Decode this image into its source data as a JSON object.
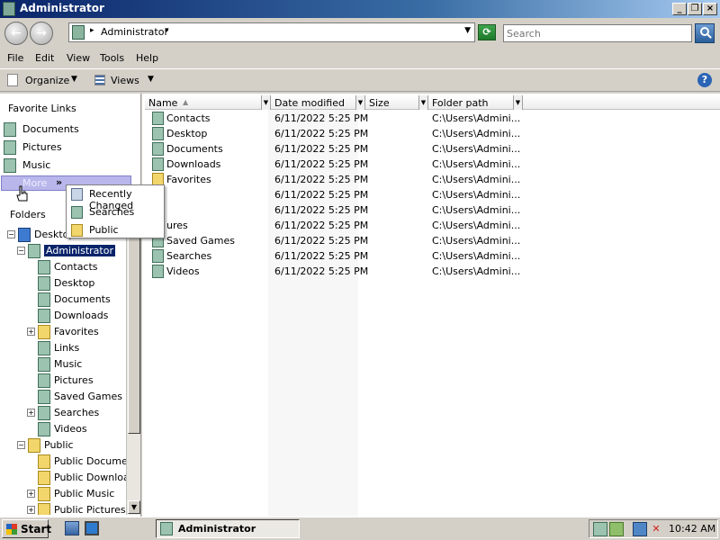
{
  "window": {
    "title": "Administrator"
  },
  "address": {
    "location": "Administrator",
    "search_placeholder": "Search"
  },
  "menu": [
    "File",
    "Edit",
    "View",
    "Tools",
    "Help"
  ],
  "toolbar": {
    "organize": "Organize",
    "views": "Views"
  },
  "nav": {
    "favorites_heading": "Favorite Links",
    "favorites": [
      "Documents",
      "Pictures",
      "Music"
    ],
    "more_label": "More",
    "more_chevron": "»",
    "folders_heading": "Folders"
  },
  "popup": {
    "items": [
      "Recently Changed",
      "Searches",
      "Public"
    ]
  },
  "tree": [
    {
      "label": "Desktop",
      "depth": 0,
      "expander": "−",
      "icon": "monitor"
    },
    {
      "label": "Administrator",
      "depth": 1,
      "expander": "−",
      "icon": "green",
      "selected": true
    },
    {
      "label": "Contacts",
      "depth": 2,
      "icon": "green"
    },
    {
      "label": "Desktop",
      "depth": 2,
      "icon": "green"
    },
    {
      "label": "Documents",
      "depth": 2,
      "icon": "green"
    },
    {
      "label": "Downloads",
      "depth": 2,
      "icon": "green"
    },
    {
      "label": "Favorites",
      "depth": 2,
      "expander": "+",
      "icon": "yellow"
    },
    {
      "label": "Links",
      "depth": 2,
      "icon": "green"
    },
    {
      "label": "Music",
      "depth": 2,
      "icon": "green"
    },
    {
      "label": "Pictures",
      "depth": 2,
      "icon": "green"
    },
    {
      "label": "Saved Games",
      "depth": 2,
      "icon": "green"
    },
    {
      "label": "Searches",
      "depth": 2,
      "expander": "+",
      "icon": "green"
    },
    {
      "label": "Videos",
      "depth": 2,
      "icon": "green"
    },
    {
      "label": "Public",
      "depth": 1,
      "expander": "−",
      "icon": "yellow"
    },
    {
      "label": "Public Documents",
      "depth": 2,
      "icon": "yellow"
    },
    {
      "label": "Public Downloads",
      "depth": 2,
      "icon": "yellow"
    },
    {
      "label": "Public Music",
      "depth": 2,
      "expander": "+",
      "icon": "yellow"
    },
    {
      "label": "Public Pictures",
      "depth": 2,
      "expander": "+",
      "icon": "yellow"
    }
  ],
  "columns": [
    "Name",
    "Date modified",
    "Size",
    "Folder path"
  ],
  "files": [
    {
      "name": "Contacts",
      "date": "6/11/2022 5:25 PM",
      "path": "C:\\Users\\Admini..."
    },
    {
      "name": "Desktop",
      "date": "6/11/2022 5:25 PM",
      "path": "C:\\Users\\Admini..."
    },
    {
      "name": "Documents",
      "date": "6/11/2022 5:25 PM",
      "path": "C:\\Users\\Admini..."
    },
    {
      "name": "Downloads",
      "date": "6/11/2022 5:25 PM",
      "path": "C:\\Users\\Admini..."
    },
    {
      "name": "Favorites",
      "date": "6/11/2022 5:25 PM",
      "path": "C:\\Users\\Admini..."
    },
    {
      "name": "",
      "date": "6/11/2022 5:25 PM",
      "path": "C:\\Users\\Admini..."
    },
    {
      "name": "",
      "date": "6/11/2022 5:25 PM",
      "path": "C:\\Users\\Admini..."
    },
    {
      "name": "ures",
      "date": "6/11/2022 5:25 PM",
      "path": "C:\\Users\\Admini..."
    },
    {
      "name": "Saved Games",
      "date": "6/11/2022 5:25 PM",
      "path": "C:\\Users\\Admini..."
    },
    {
      "name": "Searches",
      "date": "6/11/2022 5:25 PM",
      "path": "C:\\Users\\Admini..."
    },
    {
      "name": "Videos",
      "date": "6/11/2022 5:25 PM",
      "path": "C:\\Users\\Admini..."
    }
  ],
  "taskbar": {
    "start": "Start",
    "task": "Administrator",
    "clock": "10:42 AM"
  }
}
